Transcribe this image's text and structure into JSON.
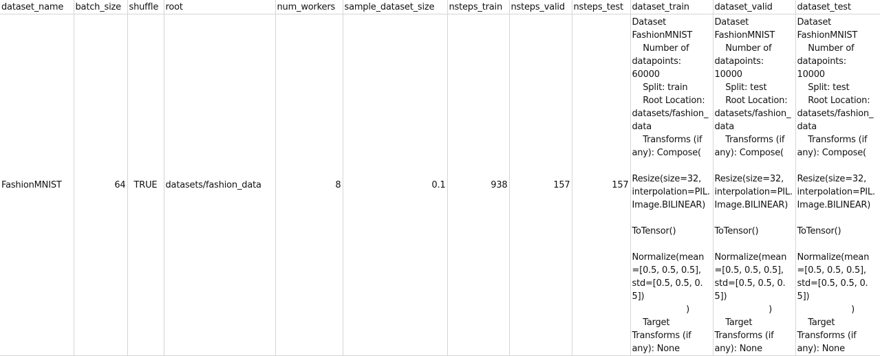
{
  "headers": [
    "dataset_name",
    "batch_size",
    "shuffle",
    "root",
    "num_workers",
    "sample_dataset_size",
    "nsteps_train",
    "nsteps_valid",
    "nsteps_test",
    "dataset_train",
    "dataset_valid",
    "dataset_test"
  ],
  "row": {
    "dataset_name": "FashionMNIST",
    "batch_size": "64",
    "shuffle": "TRUE",
    "root": "datasets/fashion_data",
    "num_workers": "8",
    "sample_dataset_size": "0.1",
    "nsteps_train": "938",
    "nsteps_valid": "157",
    "nsteps_test": "157",
    "dataset_train": "Dataset\nFashionMNIST\n    Number of\ndatapoints:\n60000\n    Split: train\n    Root Location:\ndatasets/fashion_\ndata\n    Transforms (if\nany): Compose(\n\nResize(size=32,\ninterpolation=PIL.\nImage.BILINEAR)\n\nToTensor()\n\nNormalize(mean\n=[0.5, 0.5, 0.5],\nstd=[0.5, 0.5, 0.5])\n                    )\n    Target\nTransforms (if\nany): None",
    "dataset_valid": "Dataset\nFashionMNIST\n    Number of\ndatapoints:\n10000\n    Split: test\n    Root Location:\ndatasets/fashion_\ndata\n    Transforms (if\nany): Compose(\n\nResize(size=32,\ninterpolation=PIL.\nImage.BILINEAR)\n\nToTensor()\n\nNormalize(mean\n=[0.5, 0.5, 0.5],\nstd=[0.5, 0.5, 0.5])\n                    )\n    Target\nTransforms (if\nany): None",
    "dataset_test": "Dataset\nFashionMNIST\n    Number of\ndatapoints:\n10000\n    Split: test\n    Root Location:\ndatasets/fashion_\ndata\n    Transforms (if\nany): Compose(\n\nResize(size=32,\ninterpolation=PIL.\nImage.BILINEAR)\n\nToTensor()\n\nNormalize(mean\n=[0.5, 0.5, 0.5],\nstd=[0.5, 0.5, 0.5])\n                    )\n    Target\nTransforms (if\nany): None"
  }
}
